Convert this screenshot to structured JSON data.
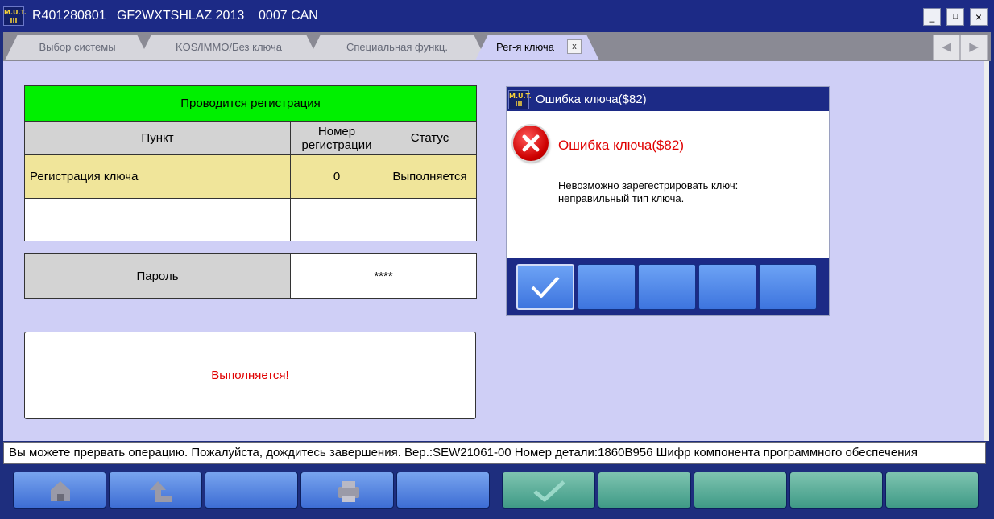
{
  "window": {
    "title": "R401280801   GF2WXTSHLAZ 2013    0007 CAN",
    "logo_text": "M.U.T.\nIII",
    "minimize": "_",
    "maximize": "□",
    "close": "×"
  },
  "tabs": [
    {
      "label": "Выбор системы",
      "active": false
    },
    {
      "label": "KOS/IMMO/Без ключа",
      "active": false
    },
    {
      "label": "Специальная функц.",
      "active": false
    },
    {
      "label": "Рег-я ключа",
      "active": true
    }
  ],
  "tab_close": "x",
  "nav": {
    "prev": "◀",
    "next": "▶"
  },
  "registration": {
    "header": "Проводится регистрация",
    "columns": [
      "Пункт",
      "Номер регистрации",
      "Статус"
    ],
    "rows": [
      {
        "item": "Регистрация ключа",
        "number": "0",
        "status": "Выполняется"
      }
    ]
  },
  "password": {
    "label": "Пароль",
    "value": "****"
  },
  "message": "Выполняется!",
  "dialog": {
    "title": "Ошибка ключа($82)",
    "error_title": "Ошибка ключа($82)",
    "line1": "Невозможно зарегестрировать ключ:",
    "line2": "неправильный тип ключа.",
    "buttons": [
      "ok-check-icon",
      "",
      "",
      "",
      ""
    ]
  },
  "status_bar": "Вы можете прервать операцию. Пожалуйста, дождитесь завершения.   Вер.:SEW21061-00 Номер детали:1860B956   Шифр компонента программного обеспечения",
  "bottom_buttons": [
    {
      "icon": "home-icon",
      "color": "blue"
    },
    {
      "icon": "back-up-arrow-icon",
      "color": "blue"
    },
    {
      "icon": "",
      "color": "blue"
    },
    {
      "icon": "printer-icon",
      "color": "blue"
    },
    {
      "icon": "",
      "color": "blue"
    },
    {
      "icon": "check-icon",
      "color": "green"
    },
    {
      "icon": "",
      "color": "green"
    },
    {
      "icon": "",
      "color": "green"
    },
    {
      "icon": "",
      "color": "green"
    },
    {
      "icon": "",
      "color": "green"
    }
  ],
  "colors": {
    "titlebar": "#1c2a86",
    "main_bg": "#cfcff6",
    "table_header": "#00f000",
    "row_highlight": "#f0e59a",
    "error_red": "#e00000",
    "button_blue": "#3d6dd4",
    "button_green": "#3f9a86"
  }
}
